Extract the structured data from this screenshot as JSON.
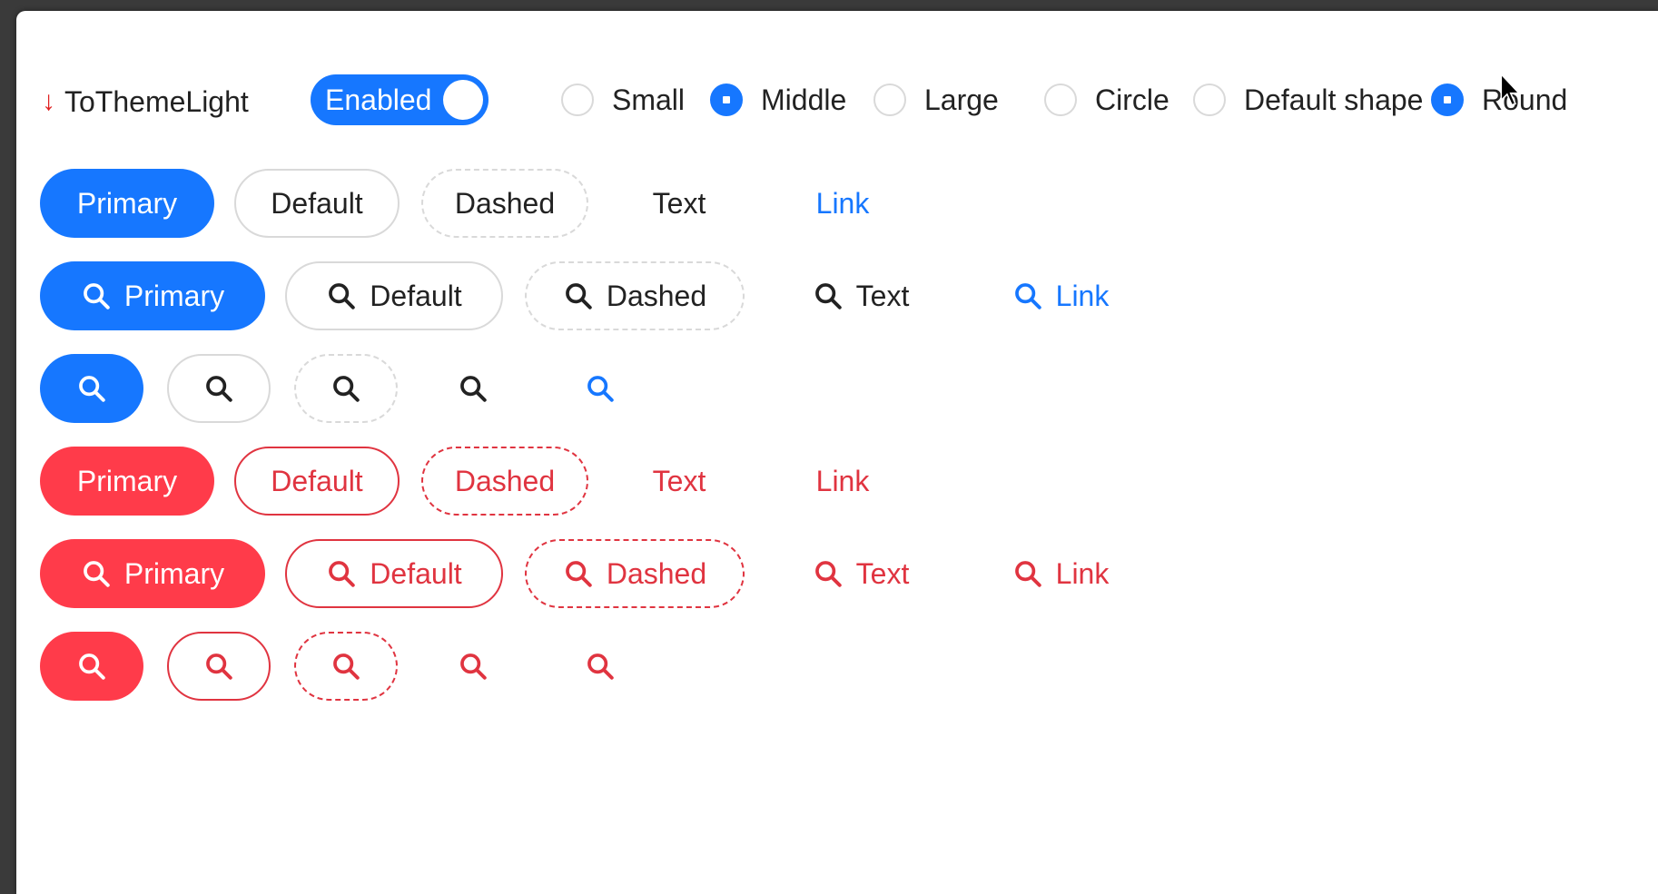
{
  "toolbar": {
    "theme_label": "ToThemeLight",
    "switch_label": "Enabled",
    "size_options": [
      "Small",
      "Middle",
      "Large"
    ],
    "size_selected": "Middle",
    "shape_options": [
      "Circle",
      "Default shape",
      "Round"
    ],
    "shape_selected": "Round"
  },
  "buttons": {
    "labels": [
      "Primary",
      "Default",
      "Dashed",
      "Text",
      "Link"
    ],
    "icon": "search-icon"
  },
  "colors": {
    "primary": "#1677ff",
    "danger": "#ff3b4a",
    "danger_text": "#e03440",
    "border": "#d9d9d9"
  }
}
